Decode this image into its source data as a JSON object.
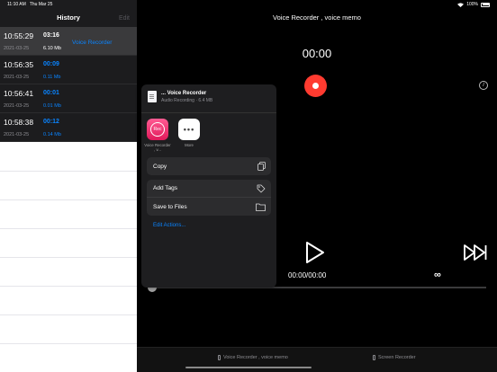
{
  "status": {
    "time": "11:10 AM",
    "date": "Thu Mar 25",
    "battery": "100%"
  },
  "sidebar": {
    "title": "History",
    "edit_label": "Edit",
    "recordings": [
      {
        "time": "10:55:29",
        "date": "2021-03-25",
        "duration": "03:16",
        "size": "6.10 Mb",
        "name": "Voice Recorder"
      },
      {
        "time": "10:56:35",
        "date": "2021-03-25",
        "duration": "00:09",
        "size": "0.11 Mb",
        "name": ""
      },
      {
        "time": "10:56:41",
        "date": "2021-03-25",
        "duration": "00:01",
        "size": "0.01 Mb",
        "name": ""
      },
      {
        "time": "10:58:38",
        "date": "2021-03-25",
        "duration": "00:12",
        "size": "0.14 Mb",
        "name": ""
      }
    ]
  },
  "main": {
    "title": "Voice Recorder , voice memo",
    "timer": "00:00",
    "timecode": "00:00/00:00",
    "loop_symbol": "∞",
    "info_symbol": "i",
    "play_progress": 0
  },
  "tabs": [
    {
      "label": "Voice Recorder , voice memo"
    },
    {
      "label": "Screen Recorder"
    }
  ],
  "share_sheet": {
    "file_title": "... Voice Recorder",
    "file_subtitle": "Audio Recording · 6.4 MB",
    "apps": [
      {
        "tile_text": "Rec",
        "label": "Voice Recorder , v..."
      },
      {
        "tile_text": "•••",
        "label": "More"
      }
    ],
    "actions_group1": [
      {
        "label": "Copy",
        "icon": "copy-icon"
      }
    ],
    "actions_group2": [
      {
        "label": "Add Tags",
        "icon": "tag-icon"
      },
      {
        "label": "Save to Files",
        "icon": "folder-icon"
      }
    ],
    "edit_actions": "Edit Actions..."
  }
}
